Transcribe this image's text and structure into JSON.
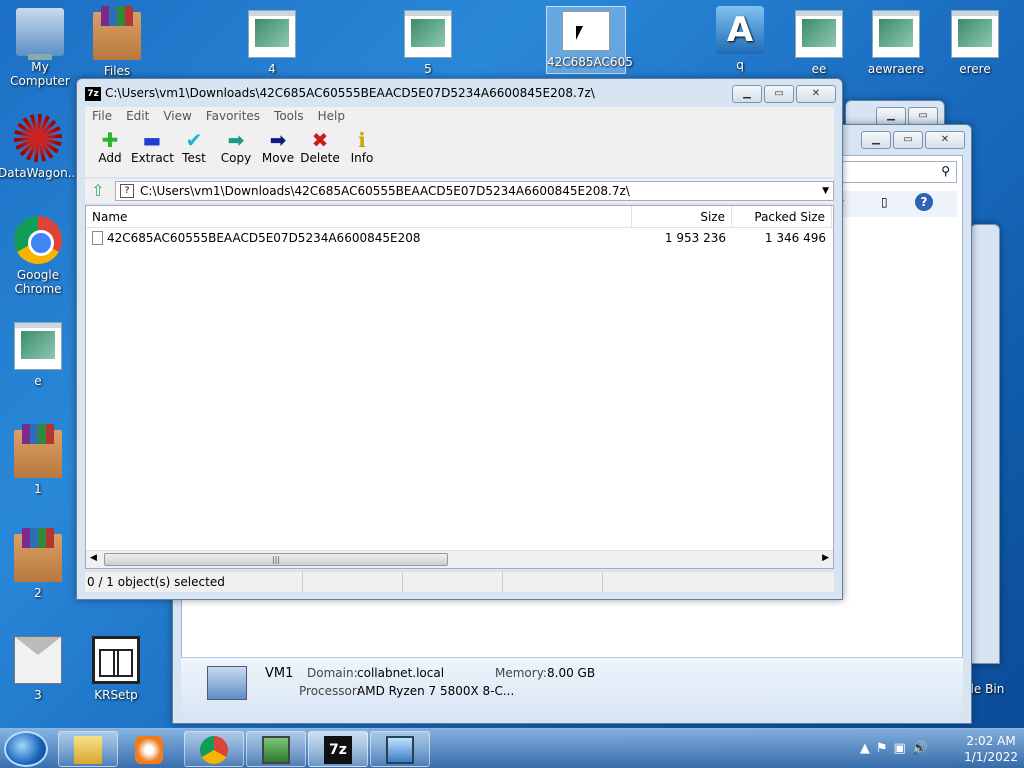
{
  "desktop": {
    "icons": [
      {
        "label": "My Computer"
      },
      {
        "label": "Files"
      },
      {
        "label": "4"
      },
      {
        "label": "5"
      },
      {
        "label": "42C685AC605"
      },
      {
        "label": "q"
      },
      {
        "label": "ee"
      },
      {
        "label": "aewraere"
      },
      {
        "label": "erere"
      },
      {
        "label": "DataWagon..."
      },
      {
        "label": "Google Chrome"
      },
      {
        "label": "e"
      },
      {
        "label": "1"
      },
      {
        "label": "2"
      },
      {
        "label": "3"
      },
      {
        "label": "KRSetp"
      },
      {
        "label": "cle Bin"
      }
    ]
  },
  "sevenzip": {
    "title": "C:\\Users\\vm1\\Downloads\\42C685AC60555BEAACD5E07D5234A6600845E208.7z\\",
    "app_icon": "7z",
    "menu": [
      "File",
      "Edit",
      "View",
      "Favorites",
      "Tools",
      "Help"
    ],
    "toolbar": [
      {
        "label": "Add",
        "icon": "plus-icon",
        "glyph": "✚",
        "color": "#2cb32c"
      },
      {
        "label": "Extract",
        "icon": "minus-icon",
        "glyph": "▬",
        "color": "#1c3fd0"
      },
      {
        "label": "Test",
        "icon": "check-icon",
        "glyph": "✔",
        "color": "#19b7c9"
      },
      {
        "label": "Copy",
        "icon": "copy-arrow-icon",
        "glyph": "➡",
        "color": "#1a9a8a"
      },
      {
        "label": "Move",
        "icon": "move-arrow-icon",
        "glyph": "➡",
        "color": "#0d1a80"
      },
      {
        "label": "Delete",
        "icon": "delete-x-icon",
        "glyph": "✖",
        "color": "#d01a1a"
      },
      {
        "label": "Info",
        "icon": "info-icon",
        "glyph": "ℹ",
        "color": "#c9a400"
      }
    ],
    "address": "C:\\Users\\vm1\\Downloads\\42C685AC60555BEAACD5E07D5234A6600845E208.7z\\",
    "columns": {
      "name": "Name",
      "size": "Size",
      "packed": "Packed Size"
    },
    "rows": [
      {
        "name": "42C685AC60555BEAACD5E07D5234A6600845E208",
        "size": "1 953 236",
        "packed": "1 346 496"
      }
    ],
    "status": "0 / 1 object(s) selected"
  },
  "explorer_details": {
    "computer_name": "VM1",
    "domain_label": "Domain:",
    "domain": "collabnet.local",
    "memory_label": "Memory:",
    "memory": "8.00 GB",
    "processor_label": "Processor:",
    "processor": "AMD Ryzen 7 5800X 8-C..."
  },
  "taskbar": {
    "time": "2:02 AM",
    "date": "1/1/2022"
  }
}
